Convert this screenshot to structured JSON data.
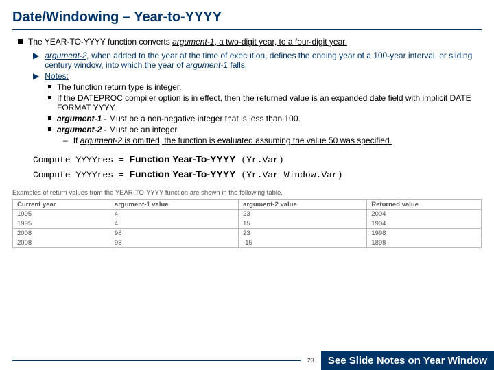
{
  "title": "Date/Windowing – Year-to-YYYY",
  "bullet1": {
    "prefix": "The ",
    "func": "YEAR-TO-YYYY function converts ",
    "arg1": "argument-1",
    "rest": ", a two-digit year, to a four-digit year."
  },
  "bullet2": {
    "arg2": "argument-2,",
    "rest": " when added to the year at the time of execution, defines the ending year of a 100-year interval, or sliding century window, into which the year of ",
    "arg1again": "argument-1",
    "tail": " falls."
  },
  "notesLabel": "Notes:",
  "notes": {
    "n1": "The function return type is integer.",
    "n2": "If the DATEPROC compiler option is in effect, then the returned value is an expanded date field with implicit DATE FORMAT YYYY.",
    "n3a": "argument-1",
    "n3b": " - Must be a non-negative integer that is less than 100.",
    "n4a": "argument-2",
    "n4b": " - Must be an integer.",
    "n5a": "If ",
    "n5b": "argument-2",
    "n5c": " is omitted, the function is evaluated assuming the value 50 was specified."
  },
  "code": {
    "l1a": "Compute YYYYres = ",
    "l1k": "Function Year-To-YYYY",
    "l1b": " (Yr.Var)",
    "l2a": "Compute YYYYres = ",
    "l2k": "Function Year-To-YYYY",
    "l2b": " (Yr.Var Window.Var)"
  },
  "examples": {
    "caption": "Examples of return values from the YEAR-TO-YYYY function are shown in the following table.",
    "headers": [
      "Current year",
      "argument-1 value",
      "argument-2 value",
      "Returned value"
    ],
    "rows": [
      [
        "1995",
        "4",
        "23",
        "2004"
      ],
      [
        "1995",
        "4",
        "15",
        "1904"
      ],
      [
        "2008",
        "98",
        "23",
        "1998"
      ],
      [
        "2008",
        "98",
        "-15",
        "1898"
      ]
    ]
  },
  "page": "23",
  "footerNote": "See Slide Notes on Year Window"
}
